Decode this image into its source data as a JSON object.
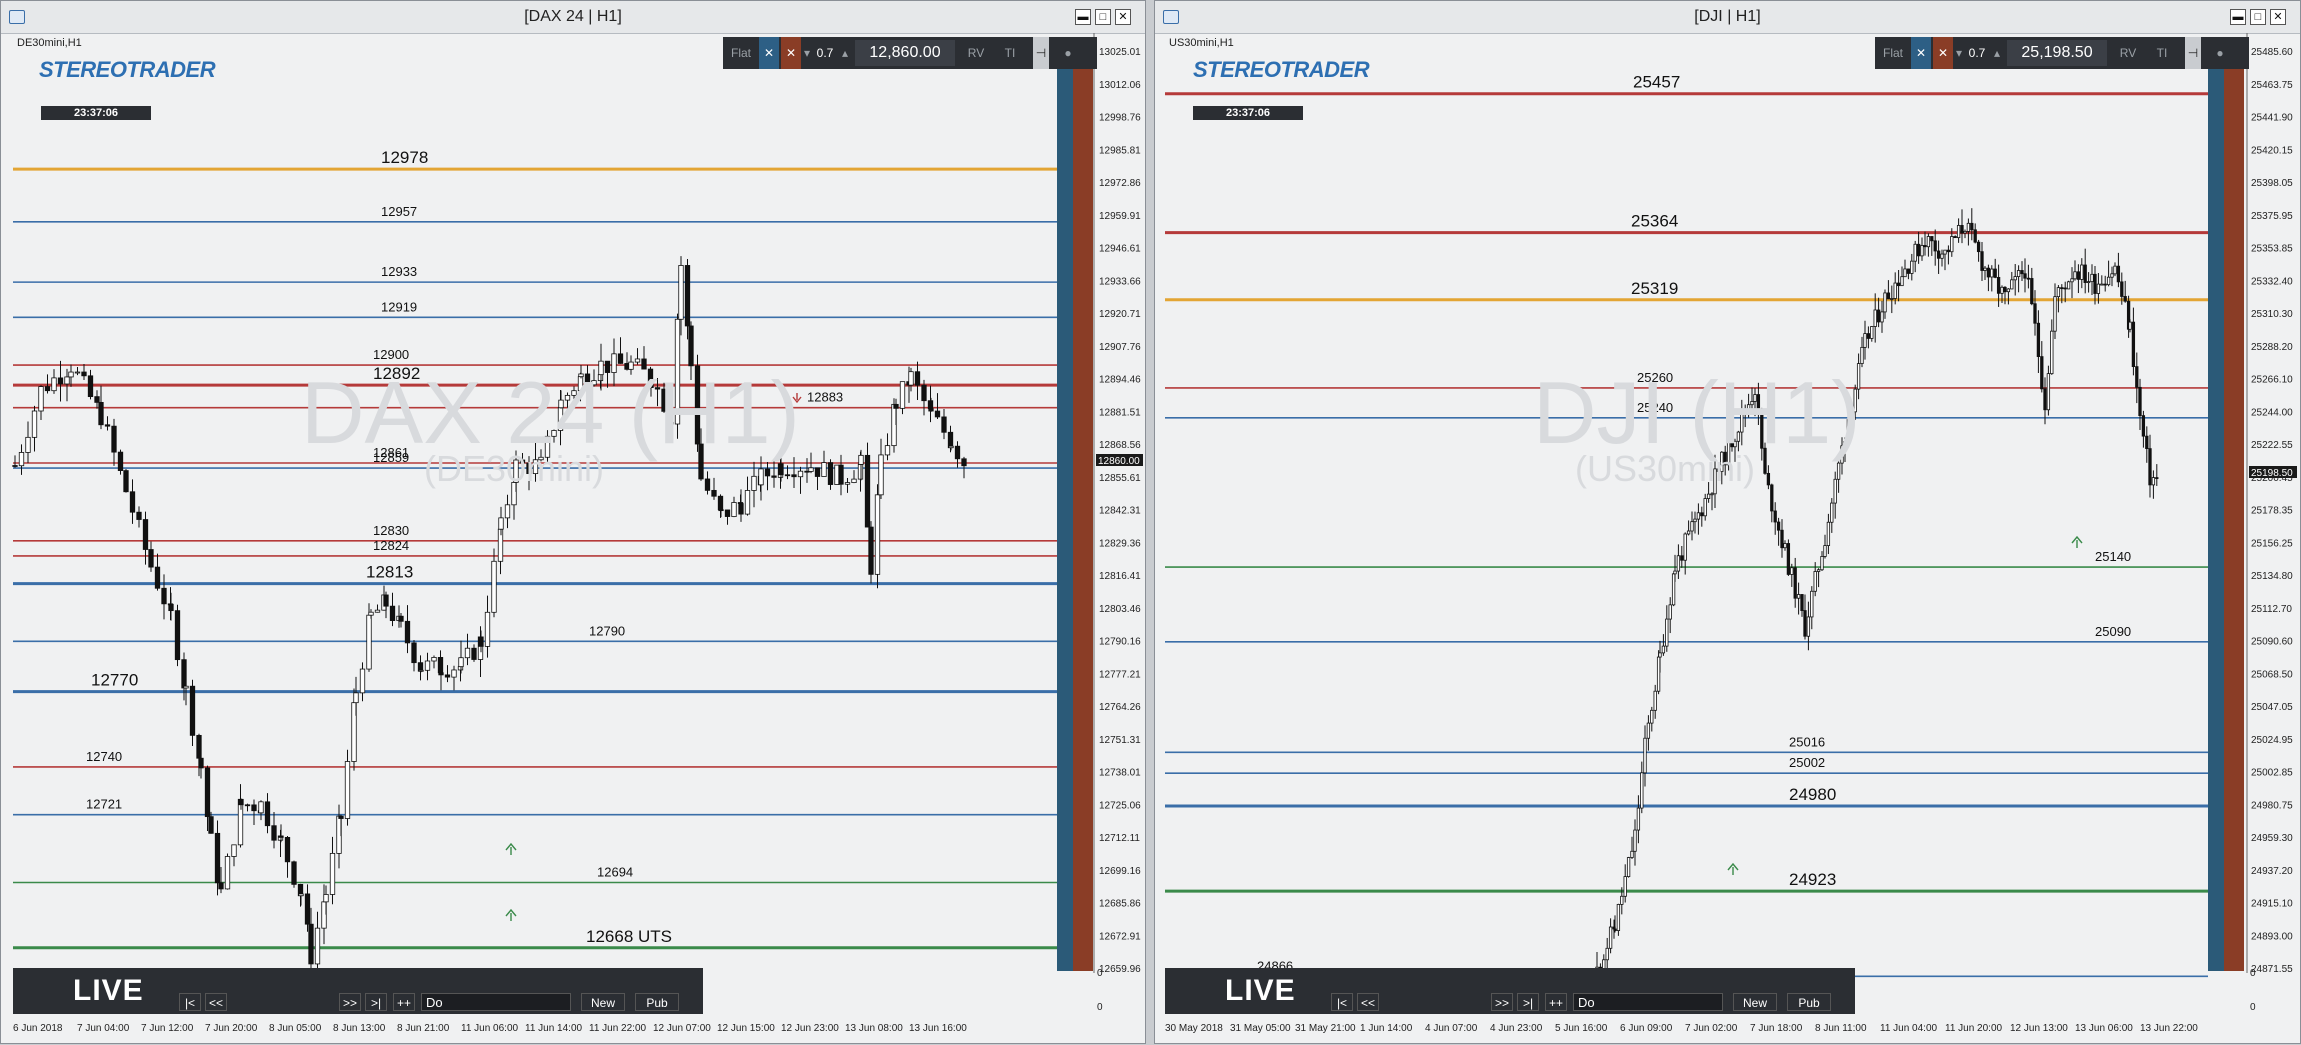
{
  "left": {
    "title": "[DAX 24 | H1]",
    "symbol": "DE30mini,H1",
    "clock": "23:37:06",
    "watermark": "DAX 24 (H1)",
    "watermark_sub": "(DE30mini)",
    "current_price_tag": "12860.00",
    "toolbar": {
      "flat": "Flat",
      "x1": "✕",
      "x2": "✕",
      "vol": "0.7",
      "price": "12,860.00",
      "rv": "RV",
      "ti": "TI"
    },
    "axis": [
      "13025.01",
      "13012.06",
      "12998.76",
      "12985.81",
      "12972.86",
      "12959.91",
      "12946.61",
      "12933.66",
      "12920.71",
      "12907.76",
      "12894.46",
      "12881.51",
      "12868.56",
      "12855.61",
      "12842.31",
      "12829.36",
      "12816.41",
      "12803.46",
      "12790.16",
      "12777.21",
      "12764.26",
      "12751.31",
      "12738.01",
      "12725.06",
      "12712.11",
      "12699.16",
      "12685.86",
      "12672.91",
      "12659.96"
    ],
    "levels": [
      {
        "label": "12978",
        "color": "#e3a534",
        "big": true
      },
      {
        "label": "12957",
        "color": "#3a6ea8"
      },
      {
        "label": "12933",
        "color": "#3a6ea8"
      },
      {
        "label": "12919",
        "color": "#3a6ea8"
      },
      {
        "label": "12900",
        "color": "#b53a3a"
      },
      {
        "label": "12892",
        "color": "#b53a3a",
        "big": true
      },
      {
        "label": "12883",
        "color": "#b53a3a"
      },
      {
        "label": "12861",
        "color": "#b53a3a"
      },
      {
        "label": "12859",
        "color": "#3a6ea8"
      },
      {
        "label": "12830",
        "color": "#b53a3a"
      },
      {
        "label": "12824",
        "color": "#b53a3a"
      },
      {
        "label": "12813",
        "color": "#3a6ea8",
        "big": true
      },
      {
        "label": "12790",
        "color": "#3a6ea8"
      },
      {
        "label": "12770",
        "color": "#3a6ea8",
        "big": true
      },
      {
        "label": "12740",
        "color": "#b53a3a"
      },
      {
        "label": "12721",
        "color": "#3a6ea8"
      },
      {
        "label": "12694",
        "color": "#3a8a4a"
      },
      {
        "label": "12668 UTS",
        "color": "#3a8a4a",
        "big": true
      }
    ],
    "dates": [
      "6 Jun 2018",
      "7 Jun 04:00",
      "7 Jun 12:00",
      "7 Jun 20:00",
      "8 Jun 05:00",
      "8 Jun 13:00",
      "8 Jun 21:00",
      "11 Jun 06:00",
      "11 Jun 14:00",
      "11 Jun 22:00",
      "12 Jun 07:00",
      "12 Jun 15:00",
      "12 Jun 23:00",
      "13 Jun 08:00",
      "13 Jun 16:00"
    ],
    "bottom": {
      "first": "|<",
      "back": "<<",
      "fwd": ">>",
      "last": ">|",
      "plus": "++",
      "input": "Do",
      "new": "New",
      "pub": "Pub",
      "live": "LIVE",
      "axis0": "0",
      "axis1": "0"
    }
  },
  "right": {
    "title": "[DJI | H1]",
    "symbol": "US30mini,H1",
    "clock": "23:37:06",
    "watermark": "DJI (H1)",
    "watermark_sub": "(US30mini)",
    "current_price_tag": "25198.50",
    "toolbar": {
      "flat": "Flat",
      "x1": "✕",
      "x2": "✕",
      "vol": "0.7",
      "price": "25,198.50",
      "rv": "RV",
      "ti": "TI"
    },
    "axis": [
      "25485.60",
      "25463.75",
      "25441.90",
      "25420.15",
      "25398.05",
      "25375.95",
      "25353.85",
      "25332.40",
      "25310.30",
      "25288.20",
      "25266.10",
      "25244.00",
      "25222.55",
      "25200.45",
      "25178.35",
      "25156.25",
      "25134.80",
      "25112.70",
      "25090.60",
      "25068.50",
      "25047.05",
      "25024.95",
      "25002.85",
      "24980.75",
      "24959.30",
      "24937.20",
      "24915.10",
      "24893.00",
      "24871.55"
    ],
    "levels": [
      {
        "label": "25457",
        "color": "#b53a3a",
        "big": true
      },
      {
        "label": "25364",
        "color": "#b53a3a",
        "big": true
      },
      {
        "label": "25319",
        "color": "#e3a534",
        "big": true
      },
      {
        "label": "25260",
        "color": "#b53a3a"
      },
      {
        "label": "25240",
        "color": "#3a6ea8"
      },
      {
        "label": "25140",
        "color": "#3a8a4a"
      },
      {
        "label": "25090",
        "color": "#3a6ea8"
      },
      {
        "label": "25016",
        "color": "#3a6ea8"
      },
      {
        "label": "25002",
        "color": "#3a6ea8"
      },
      {
        "label": "24980",
        "color": "#3a6ea8",
        "big": true
      },
      {
        "label": "24923",
        "color": "#3a8a4a",
        "big": true
      },
      {
        "label": "24866",
        "color": "#3a6ea8"
      }
    ],
    "dates": [
      "30 May 2018",
      "31 May 05:00",
      "31 May 21:00",
      "1 Jun 14:00",
      "4 Jun 07:00",
      "4 Jun 23:00",
      "5 Jun 16:00",
      "6 Jun 09:00",
      "7 Jun 02:00",
      "7 Jun 18:00",
      "8 Jun 11:00",
      "11 Jun 04:00",
      "11 Jun 20:00",
      "12 Jun 13:00",
      "13 Jun 06:00",
      "13 Jun 22:00"
    ],
    "bottom": {
      "first": "|<",
      "back": "<<",
      "fwd": ">>",
      "last": ">|",
      "plus": "++",
      "input": "Do",
      "new": "New",
      "pub": "Pub",
      "live": "LIVE",
      "axis0": "0",
      "axis1": "0"
    }
  },
  "logo_text": "STEREOTRADER",
  "colors": {
    "blue": "#3a6ea8",
    "red": "#b53a3a",
    "gold": "#e3a534",
    "green": "#3a8a4a",
    "panel": "#2b2e33"
  }
}
